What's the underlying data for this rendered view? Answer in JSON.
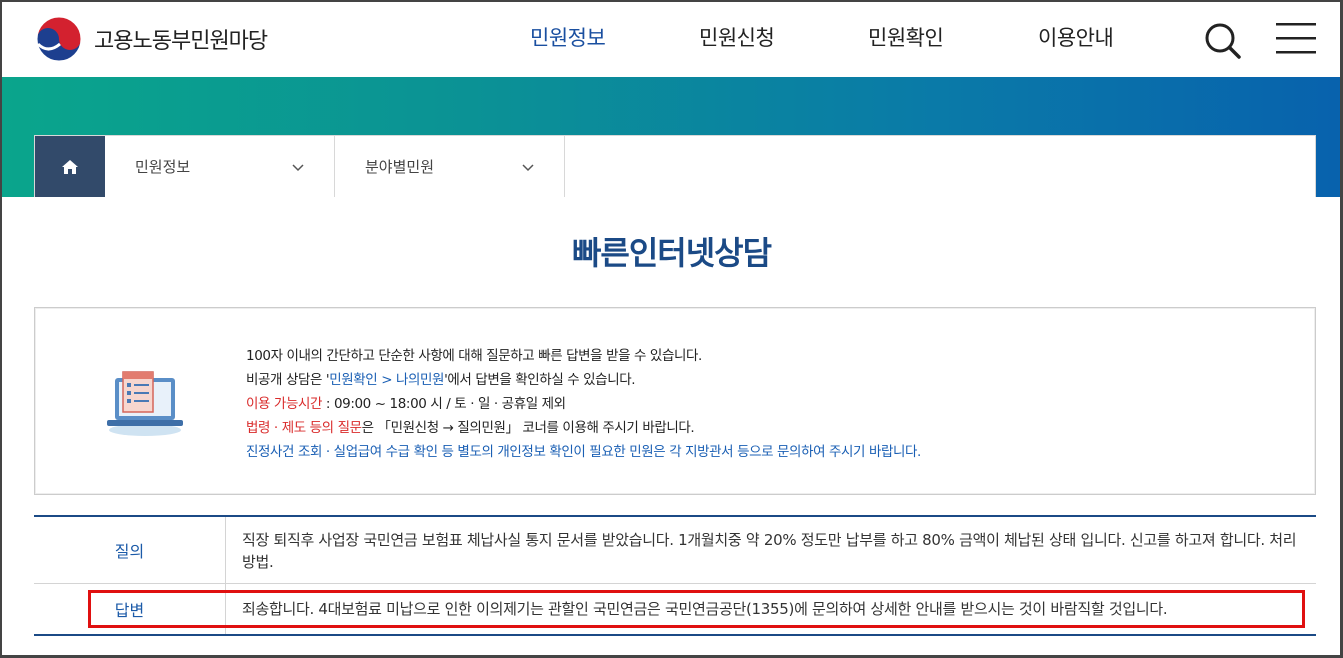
{
  "header": {
    "logo_text": "고용노동부민원마당",
    "nav": [
      {
        "label": "민원정보",
        "active": true
      },
      {
        "label": "민원신청",
        "active": false
      },
      {
        "label": "민원확인",
        "active": false
      },
      {
        "label": "이용안내",
        "active": false
      }
    ],
    "icons": {
      "search": "search-icon",
      "menu": "hamburger-icon"
    }
  },
  "breadcrumb": {
    "home_icon": "home-icon",
    "items": [
      {
        "label": "민원정보"
      },
      {
        "label": "분야별민원"
      }
    ]
  },
  "page": {
    "title": "빠른인터넷상담"
  },
  "info": {
    "line1": "100자 이내의 간단하고 단순한 사항에 대해 질문하고 빠른 답변을 받을 수 있습니다.",
    "line2_pre": "비공개 상담은 '",
    "line2_link": "민원확인 > 나의민원",
    "line2_post": "'에서 답변을 확인하실 수 있습니다.",
    "line3_label": "이용 가능시간",
    "line3_text": " : 09:00 ~ 18:00 시 / 토 · 일 · 공휴일 제외",
    "line4_label": "법령 · 제도 등의 질문",
    "line4_text": "은 「민원신청 → 질의민원」 코너를 이용해 주시기 바랍니다.",
    "line5": "진정사건 조회 · 실업급여 수급 확인 등 별도의 개인정보 확인이 필요한 민원은 각 지방관서 등으로 문의하여 주시기 바랍니다."
  },
  "qa": {
    "question_label": "질의",
    "question_text": "직장 퇴직후 사업장 국민연금 보험표 체납사실 통지 문서를 받았습니다. 1개월치중 약 20% 정도만 납부를 하고 80% 금액이 체납된 상태 입니다. 신고를 하고져 합니다. 처리 방법.",
    "answer_label": "답변",
    "answer_text": "죄송합니다. 4대보험료 미납으로 인한 이의제기는 관할인 국민연금은 국민연금공단(1355)에 문의하여 상세한 안내를 받으시는 것이 바람직할 것입니다."
  },
  "colors": {
    "nav_active": "#1a4fa0",
    "title": "#1b4a86",
    "highlight": "#e01010",
    "red_text": "#d92b2b",
    "blue_text": "#1a5fb4"
  }
}
